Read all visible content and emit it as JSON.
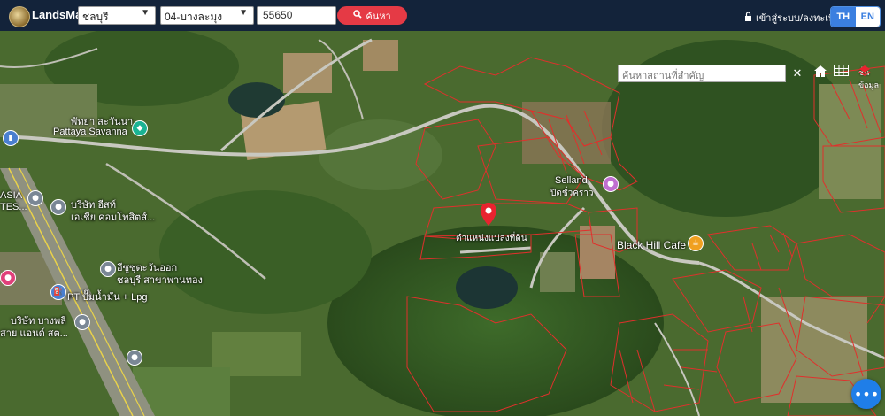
{
  "header": {
    "brand": "LandsMaps",
    "province": "ชลบุรี",
    "district": "04-บางละมุง",
    "deed_number": "55650",
    "search_button": "ค้นหา",
    "login_link": "เข้าสู่ระบบ/ลงทะเบียน",
    "lang_th": "TH",
    "lang_en": "EN"
  },
  "map": {
    "search_placeholder": "ค้นหาสถานที่สำคัญ",
    "clear_symbol": "✕",
    "layers_label": "ชั้นข้อมูล",
    "parcel_label": "ตำแหน่งแปลงที่ดิน",
    "places": {
      "pattaya_savanna_th": "พัทยา สะวันนา",
      "pattaya_savanna_en": "Pattaya Savanna",
      "asia_tes": "ASIA\nTES...",
      "company_line1": "บริษัท อีสท์",
      "company_line2": "เอเชีย คอมโพสิตส์...",
      "isuzu_line1": "อีซูซุตะวันออก",
      "isuzu_line2": "ชลบุรี สาขาพานทอง",
      "pt_station": "PT ปั๊มน้ำมัน + Lpg",
      "bangphli_line1": "บริษัท บางพลี",
      "bangphli_line2": "สาย แอนด์ สต...",
      "selland_en": "Selland",
      "selland_th": "ปิดชั่วคราว",
      "black_hill_cafe": "Black Hill Cafe"
    }
  },
  "colors": {
    "topbar": "#13233a",
    "search_button": "#e53a45",
    "parcel_lines": "#e0302c",
    "lang_active": "#3b7fe0",
    "chat_button": "#1f7ee8"
  }
}
